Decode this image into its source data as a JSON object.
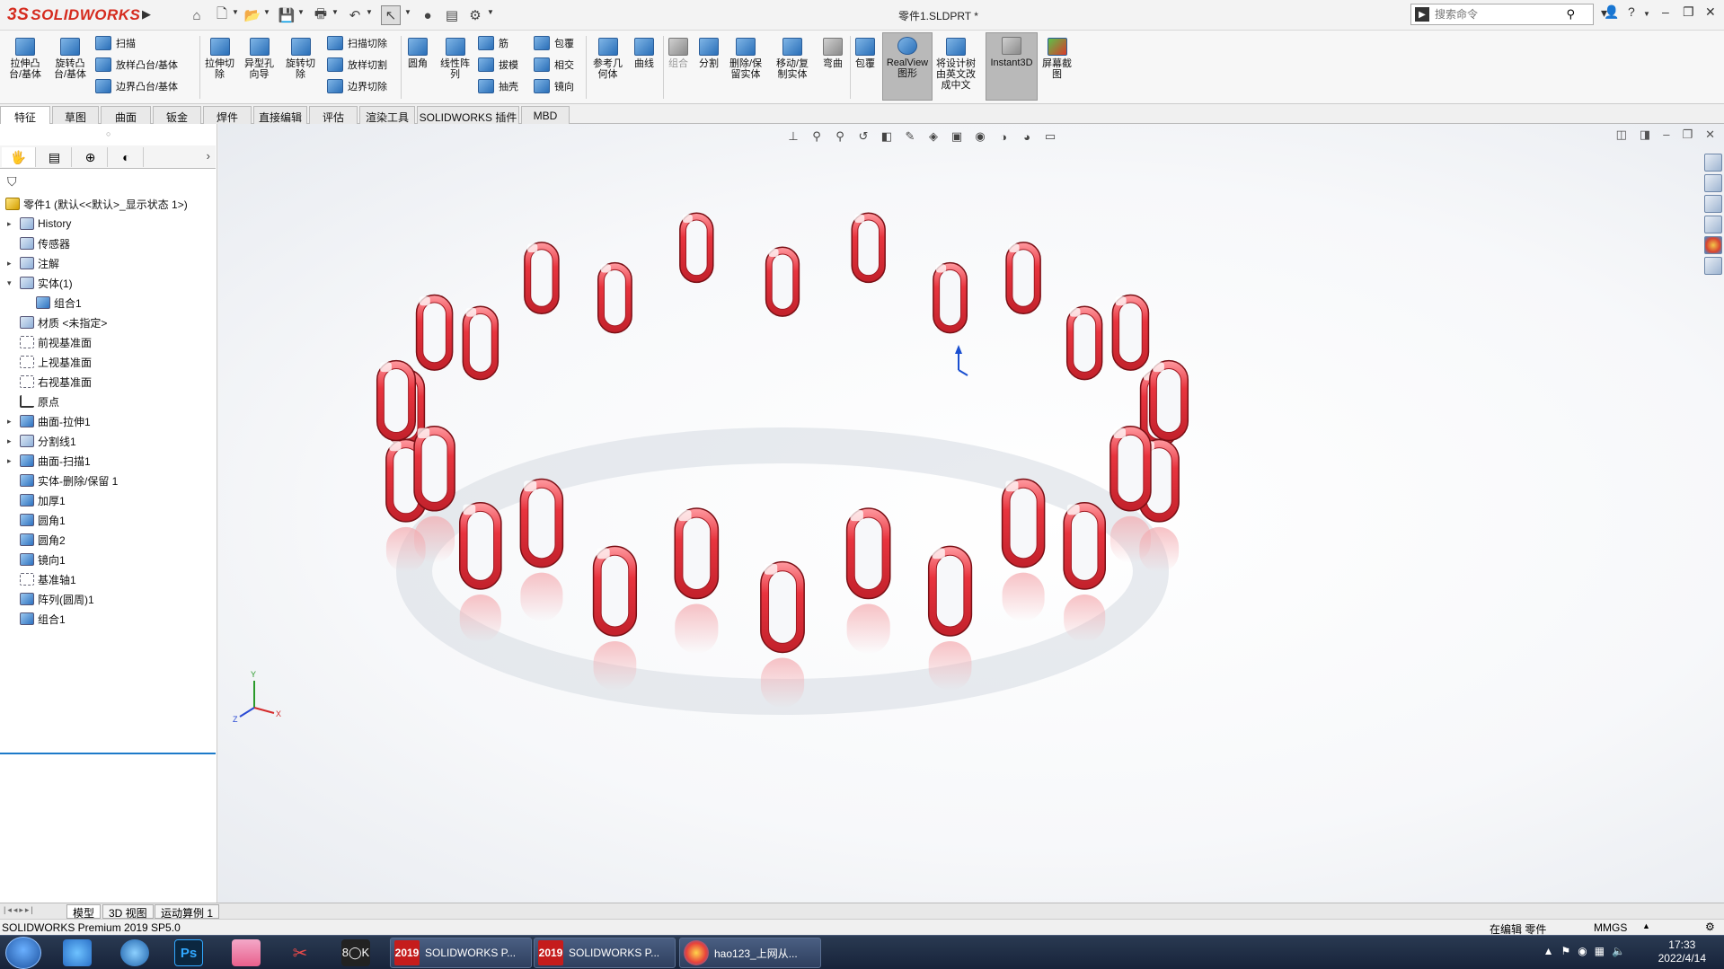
{
  "app": {
    "brand_ds": "3S",
    "brand_name": "SOLIDWORKS",
    "doc_title": "零件1.SLDPRT *"
  },
  "search": {
    "placeholder": "搜索命令"
  },
  "ribbon": {
    "extrude_boss": "拉伸凸\n台/基体",
    "revolve_boss": "旋转凸\n台/基体",
    "sweep": "扫描",
    "loft_boss": "放样凸台/基体",
    "boundary_boss": "边界凸台/基体",
    "extrude_cut": "拉伸切\n除",
    "hole_wizard": "异型孔\n向导",
    "revolve_cut": "旋转切\n除",
    "sweep_cut": "扫描切除",
    "loft_cut": "放样切割",
    "boundary_cut": "边界切除",
    "fillet": "圆角",
    "linear_pattern": "线性阵\n列",
    "rib": "筋",
    "draft": "拔模",
    "shell": "抽壳",
    "wrap": "包覆",
    "intersect": "相交",
    "mirror": "镜向",
    "ref_geometry": "参考几\n何体",
    "curves": "曲线",
    "combine": "组合",
    "split": "分割",
    "delete_keep_body": "删除/保\n留实体",
    "move_copy_body": "移动/复\n制实体",
    "flex": "弯曲",
    "wrap2": "包覆",
    "realview": "RealView\n图形",
    "translate_tree": "将设计树\n由英文改\n成中文",
    "instant3d": "Instant3D",
    "screen_capture": "屏幕截\n图"
  },
  "tabs": [
    "特征",
    "草图",
    "曲面",
    "钣金",
    "焊件",
    "直接编辑",
    "评估",
    "渲染工具",
    "SOLIDWORKS 插件",
    "MBD"
  ],
  "tree": [
    {
      "label": "零件1  (默认<<默认>_显示状态 1>)",
      "indent": 0,
      "expand": "",
      "icon": "yellow"
    },
    {
      "label": "History",
      "indent": 1,
      "expand": "▸",
      "icon": "folder"
    },
    {
      "label": "传感器",
      "indent": 1,
      "expand": "",
      "icon": "folder"
    },
    {
      "label": "注解",
      "indent": 1,
      "expand": "▸",
      "icon": "folder"
    },
    {
      "label": "实体(1)",
      "indent": 1,
      "expand": "▾",
      "icon": "folder"
    },
    {
      "label": "组合1",
      "indent": 2,
      "expand": "",
      "icon": "solid"
    },
    {
      "label": "材质 <未指定>",
      "indent": 1,
      "expand": "",
      "icon": "folder"
    },
    {
      "label": "前视基准面",
      "indent": 1,
      "expand": "",
      "icon": "plane"
    },
    {
      "label": "上视基准面",
      "indent": 1,
      "expand": "",
      "icon": "plane"
    },
    {
      "label": "右视基准面",
      "indent": 1,
      "expand": "",
      "icon": "plane"
    },
    {
      "label": "原点",
      "indent": 1,
      "expand": "",
      "icon": "org"
    },
    {
      "label": "曲面-拉伸1",
      "indent": 1,
      "expand": "▸",
      "icon": "solid"
    },
    {
      "label": "分割线1",
      "indent": 1,
      "expand": "▸",
      "icon": "folder"
    },
    {
      "label": "曲面-扫描1",
      "indent": 1,
      "expand": "▸",
      "icon": "solid"
    },
    {
      "label": "实体-删除/保留 1",
      "indent": 1,
      "expand": "",
      "icon": "solid"
    },
    {
      "label": "加厚1",
      "indent": 1,
      "expand": "",
      "icon": "solid"
    },
    {
      "label": "圆角1",
      "indent": 1,
      "expand": "",
      "icon": "solid"
    },
    {
      "label": "圆角2",
      "indent": 1,
      "expand": "",
      "icon": "solid"
    },
    {
      "label": "镜向1",
      "indent": 1,
      "expand": "",
      "icon": "solid"
    },
    {
      "label": "基准轴1",
      "indent": 1,
      "expand": "",
      "icon": "plane"
    },
    {
      "label": "阵列(圆周)1",
      "indent": 1,
      "expand": "",
      "icon": "solid"
    },
    {
      "label": "组合1",
      "indent": 1,
      "expand": "",
      "icon": "solid"
    }
  ],
  "bottom_tabs": [
    "模型",
    "3D 视图",
    "运动算例 1"
  ],
  "status": {
    "left": "SOLIDWORKS Premium 2019 SP5.0",
    "editing": "在编辑 零件",
    "units": "MMGS"
  },
  "taskbar": {
    "task1": "SOLIDWORKS P...",
    "task2": "SOLIDWORKS P...",
    "task3": "hao123_上网从...",
    "sw_year": "2019",
    "time": "17:33",
    "date": "2022/4/14"
  },
  "colors": {
    "band": "#e8343e",
    "band_light": "#ff8f95",
    "accent": "#d52b1e"
  }
}
